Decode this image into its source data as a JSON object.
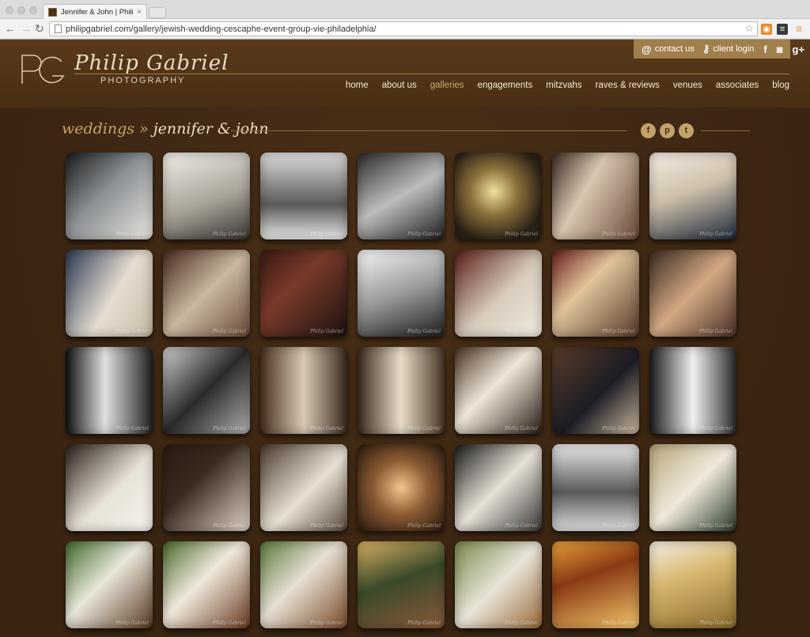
{
  "browser": {
    "tab_title": "Jennifer & John | Philip Ga",
    "tab_close": "×",
    "url": "philipgabriel.com/gallery/jewish-wedding-cescaphe-event-group-vie-philadelphia/"
  },
  "header": {
    "logo_mark": "PG",
    "logo_name": "Philip Gabriel",
    "logo_sub": "PHOTOGRAPHY",
    "utility": {
      "contact_icon": "@",
      "contact_label": "contact us",
      "login_label": "client login",
      "facebook": "f",
      "instagram": "◙",
      "googleplus": "g+"
    },
    "nav": [
      "home",
      "about us",
      "galleries",
      "engagements",
      "mitzvahs",
      "raves & reviews",
      "venues",
      "associates",
      "blog"
    ],
    "nav_active": "galleries"
  },
  "breadcrumb": {
    "section": "weddings",
    "sep": "»",
    "current": "jennifer & john"
  },
  "share": {
    "facebook": "f",
    "pinterest": "p",
    "twitter": "t"
  },
  "watermark": "Philip Gabriel",
  "colors": {
    "accent": "#c9a464",
    "background": "#3d2813",
    "header": "#4a2f14",
    "utility_bar": "#a07f4c"
  }
}
